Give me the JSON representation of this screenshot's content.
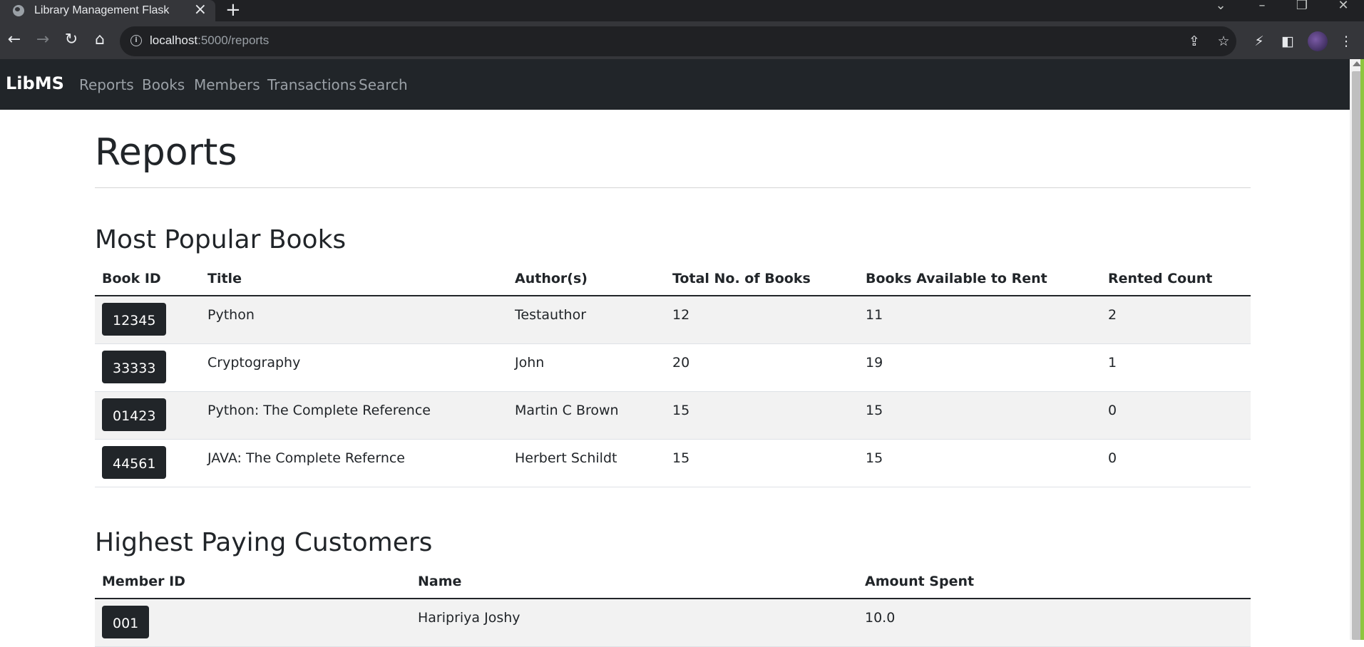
{
  "browser": {
    "tab_title": "Library Management Flask",
    "url_host": "localhost",
    "url_path": ":5000/reports"
  },
  "icons": {
    "back": "back-arrow-icon",
    "forward": "forward-arrow-icon",
    "reload": "reload-icon",
    "home": "home-icon",
    "share": "share-icon",
    "bookmark": "star-icon",
    "extensions": "extensions-icon",
    "sidepanel": "side-panel-icon",
    "menu": "kebab-menu-icon"
  },
  "navbar": {
    "brand": "LibMS",
    "links": [
      "Reports",
      "Books",
      "Members",
      "Transactions",
      "Search"
    ]
  },
  "page": {
    "title": "Reports"
  },
  "popular_books": {
    "title": "Most Popular Books",
    "headers": [
      "Book ID",
      "Title",
      "Author(s)",
      "Total No. of Books",
      "Books Available to Rent",
      "Rented Count"
    ],
    "rows": [
      {
        "id": "12345",
        "title": "Python",
        "author": "Testauthor",
        "total": "12",
        "available": "11",
        "rented": "2"
      },
      {
        "id": "33333",
        "title": "Cryptography",
        "author": "John",
        "total": "20",
        "available": "19",
        "rented": "1"
      },
      {
        "id": "01423",
        "title": "Python: The Complete Reference",
        "author": "Martin C Brown",
        "total": "15",
        "available": "15",
        "rented": "0"
      },
      {
        "id": "44561",
        "title": "JAVA: The Complete Refernce",
        "author": "Herbert Schildt",
        "total": "15",
        "available": "15",
        "rented": "0"
      }
    ]
  },
  "top_customers": {
    "title": "Highest Paying Customers",
    "headers": [
      "Member ID",
      "Name",
      "Amount Spent"
    ],
    "rows": [
      {
        "id": "001",
        "name": "Haripriya Joshy",
        "amount": "10.0"
      }
    ]
  },
  "colors": {
    "navbar_bg": "#212529",
    "badge_bg": "#212529",
    "stripe_bg": "#f2f2f2",
    "accent_bar": "#8dc63f"
  }
}
